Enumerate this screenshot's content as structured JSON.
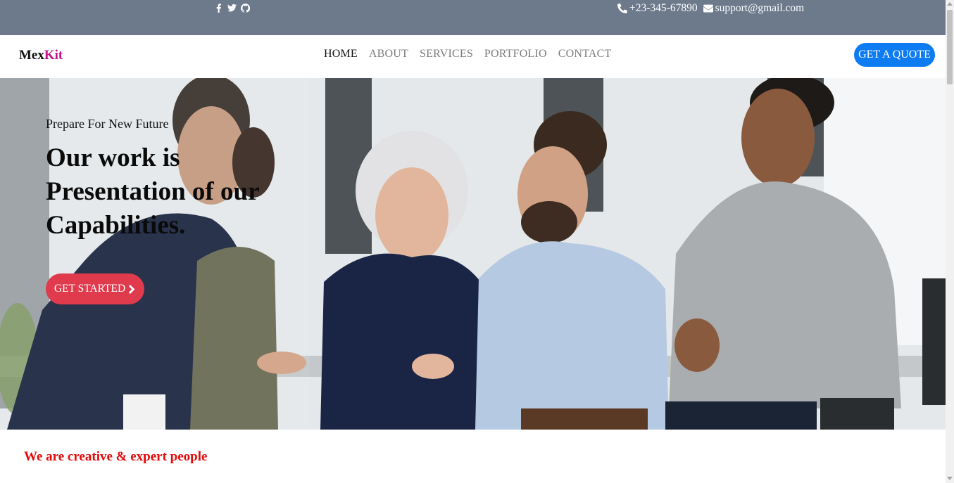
{
  "topbar": {
    "social_icons": [
      "facebook-icon",
      "twitter-icon",
      "github-icon"
    ],
    "phone": "+23-345-67890",
    "email": "support@gmail.com",
    "background": "#6c7a8c"
  },
  "navbar": {
    "brand_part1": "Mex",
    "brand_part2": "Kit",
    "brand_accent": "#c2138a",
    "items": [
      {
        "label": "HOME",
        "active": true
      },
      {
        "label": "ABOUT",
        "active": false
      },
      {
        "label": "SERVICES",
        "active": false
      },
      {
        "label": "PORTFOLIO",
        "active": false
      },
      {
        "label": "CONTACT",
        "active": false
      }
    ],
    "quote_label": "GET A QUOTE",
    "quote_color": "#0d7cf2"
  },
  "hero": {
    "eyebrow": "Prepare For New Future",
    "headline": "Our work is Presentation of our Capabilities.",
    "cta_label": "GET STARTED",
    "cta_icon": "chevron-right-icon",
    "cta_color": "#e03a4d"
  },
  "section": {
    "title": "We are creative & expert people",
    "title_color": "#e50a0a"
  }
}
